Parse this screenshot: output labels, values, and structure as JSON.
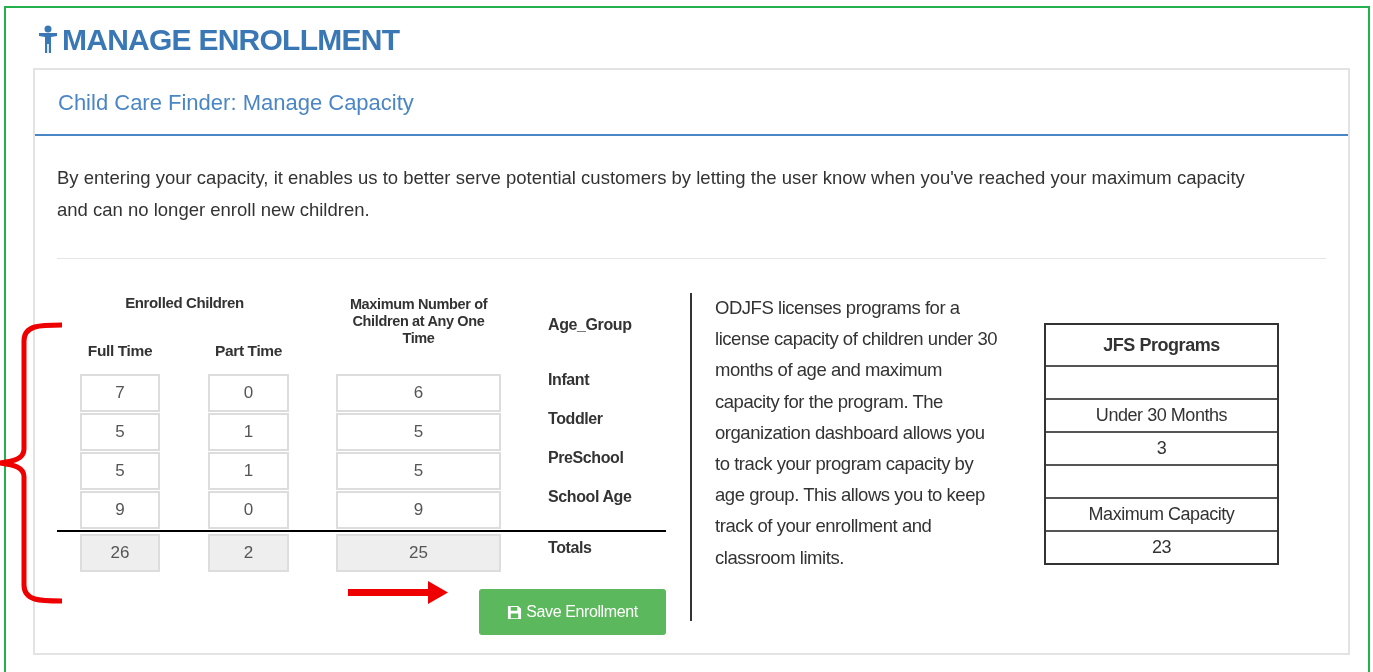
{
  "page_title": "MANAGE ENROLLMENT",
  "panel": {
    "title": "Child Care Finder: Manage Capacity",
    "intro": "By entering your capacity, it enables us to better serve potential customers by letting the user know when you've reached your maximum capacity and can no longer enroll new children.",
    "enrollment": {
      "group_header": "Enrolled Children",
      "columns": [
        "Full Time",
        "Part Time",
        "Maximum Number of Children at Any One Time",
        "Age_Group"
      ],
      "rows": [
        {
          "full_time": "7",
          "part_time": "0",
          "maximum": "6",
          "age_group": "Infant",
          "disabled": false
        },
        {
          "full_time": "5",
          "part_time": "1",
          "maximum": "5",
          "age_group": "Toddler",
          "disabled": false
        },
        {
          "full_time": "5",
          "part_time": "1",
          "maximum": "5",
          "age_group": "PreSchool",
          "disabled": false
        },
        {
          "full_time": "9",
          "part_time": "0",
          "maximum": "9",
          "age_group": "School Age",
          "disabled": false
        },
        {
          "full_time": "26",
          "part_time": "2",
          "maximum": "25",
          "age_group": "Totals",
          "disabled": true
        }
      ],
      "save_button": "Save Enrollment"
    },
    "info": "ODJFS licenses programs for a license capacity of children under 30 months of age and maximum capacity for the program. The organization dashboard allows you to track your program capacity by age group. This allows you to keep track of your enrollment and classroom limits.",
    "jfs_table": [
      {
        "kind": "header",
        "text": "JFS Programs"
      },
      {
        "kind": "blank"
      },
      {
        "kind": "cell",
        "text": "Under 30 Months"
      },
      {
        "kind": "cell",
        "text": "3"
      },
      {
        "kind": "blank"
      },
      {
        "kind": "cell",
        "text": "Maximum Capacity"
      },
      {
        "kind": "cell",
        "text": "23"
      }
    ]
  }
}
